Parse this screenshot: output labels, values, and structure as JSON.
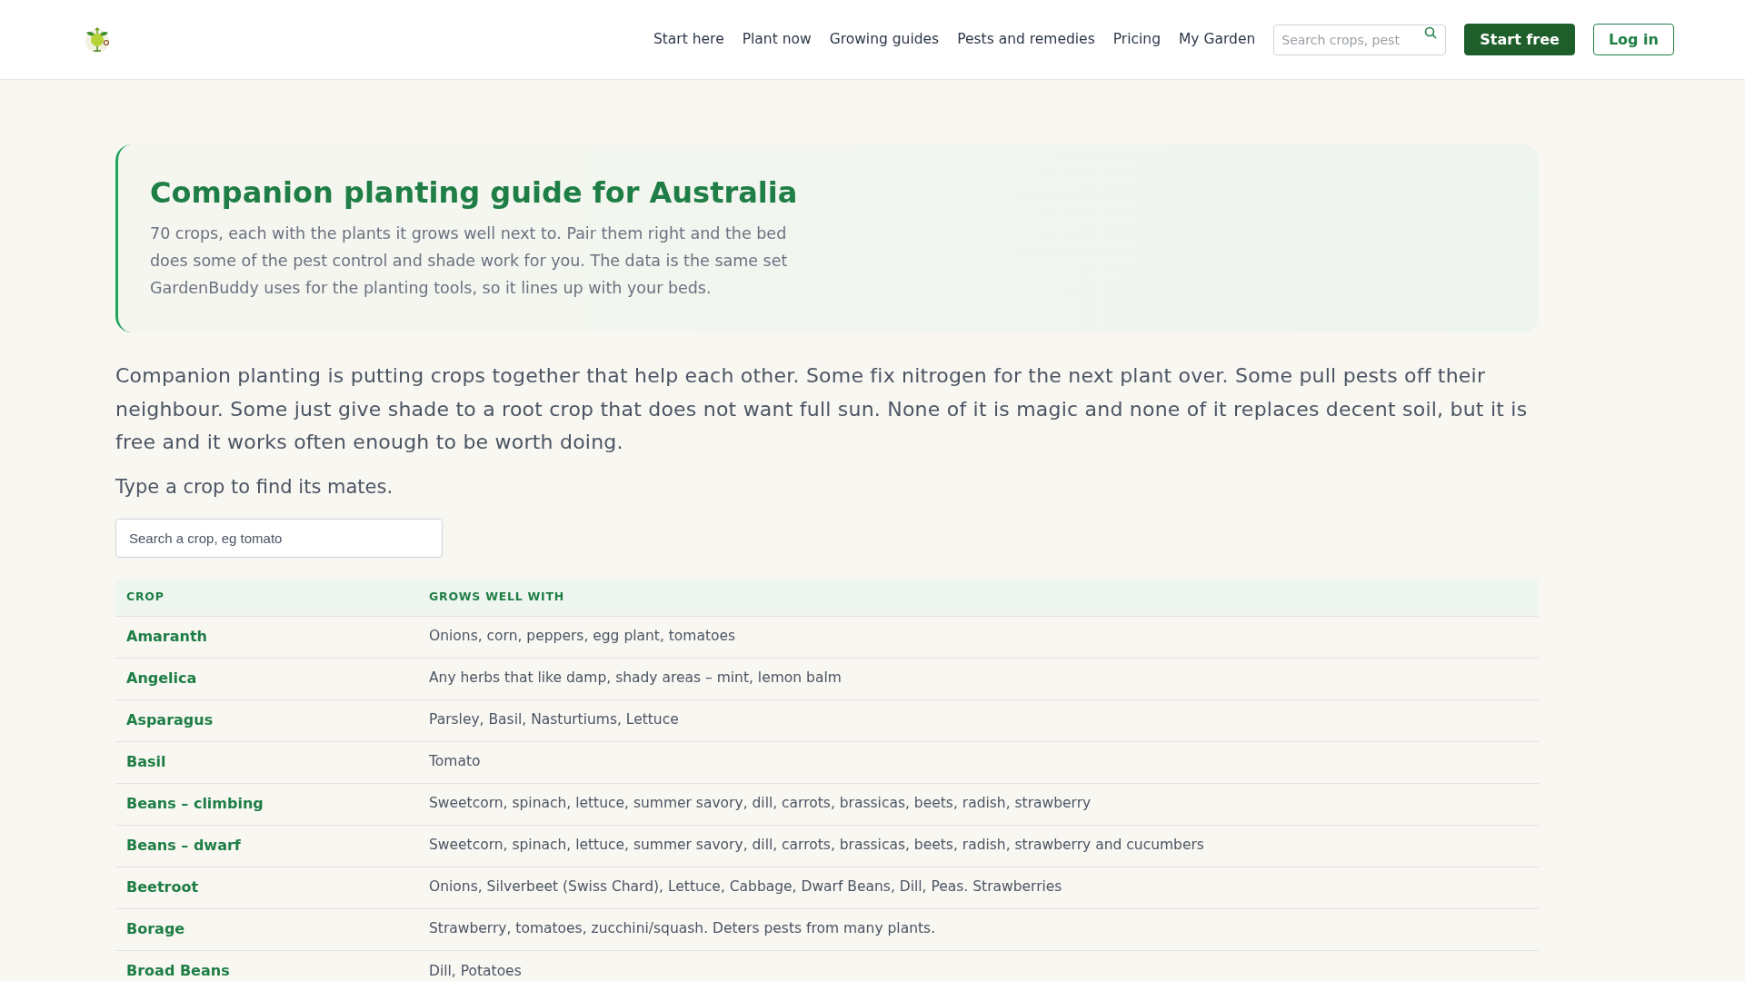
{
  "header": {
    "nav": [
      "Start here",
      "Plant now",
      "Growing guides",
      "Pests and remedies",
      "Pricing",
      "My Garden"
    ],
    "search": {
      "placeholder": "Search crops, pest"
    },
    "buttons": [
      {
        "kind": "primary",
        "label": "Start free"
      },
      {
        "kind": "outline",
        "label": "Log in"
      }
    ]
  },
  "hero": {
    "title": "Companion planting guide for Australia",
    "text": "70 crops, each with the plants it grows well next to. Pair them right and the bed does some of the pest control and shade work for you. The data is the same set GardenBuddy uses for the planting tools, so it lines up with your beds."
  },
  "intro": "Companion planting is putting crops together that help each other. Some fix nitrogen for the next plant over. Some pull pests off their neighbour. Some just give shade to a root crop that does not want full sun. None of it is magic and none of it replaces decent soil, but it is free and it works often enough to be worth doing.",
  "prompt": "Type a crop to find its mates.",
  "crop_search": {
    "placeholder": "Search a crop, eg tomato"
  },
  "table": {
    "columns": [
      "CROP",
      "GROWS WELL WITH"
    ],
    "rows": [
      {
        "crop": "Amaranth",
        "mates": "Onions, corn, peppers, egg plant, tomatoes"
      },
      {
        "crop": "Angelica",
        "mates": "Any herbs that like damp, shady areas – mint, lemon balm"
      },
      {
        "crop": "Asparagus",
        "mates": "Parsley, Basil, Nasturtiums, Lettuce"
      },
      {
        "crop": "Basil",
        "mates": "Tomato"
      },
      {
        "crop": "Beans – climbing",
        "mates": "Sweetcorn, spinach, lettuce, summer savory, dill, carrots, brassicas, beets, radish, strawberry"
      },
      {
        "crop": "Beans – dwarf",
        "mates": "Sweetcorn, spinach, lettuce, summer savory, dill, carrots, brassicas, beets, radish, strawberry and cucumbers"
      },
      {
        "crop": "Beetroot",
        "mates": "Onions, Silverbeet (Swiss Chard), Lettuce, Cabbage, Dwarf Beans, Dill, Peas. Strawberries"
      },
      {
        "crop": "Borage",
        "mates": "Strawberry, tomatoes, zucchini/squash. Deters pests from many plants."
      },
      {
        "crop": "Broad Beans",
        "mates": "Dill, Potatoes"
      }
    ]
  }
}
